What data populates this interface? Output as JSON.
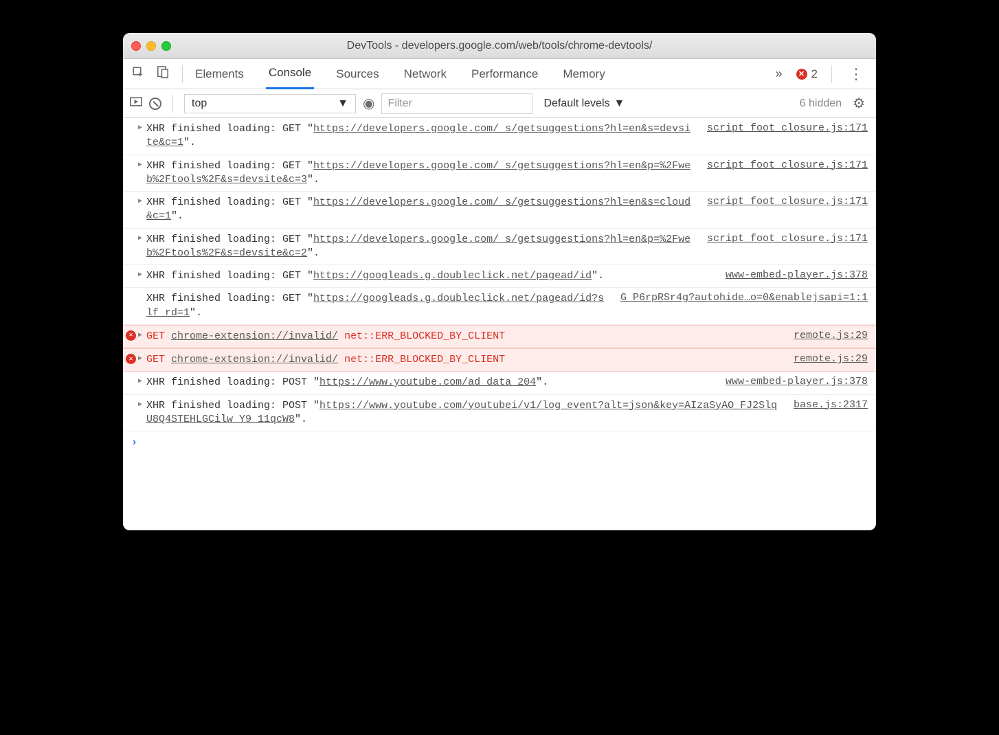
{
  "window": {
    "title": "DevTools - developers.google.com/web/tools/chrome-devtools/"
  },
  "tabs": {
    "items": [
      "Elements",
      "Console",
      "Sources",
      "Network",
      "Performance",
      "Memory"
    ],
    "active": "Console",
    "overflow_glyph": "»",
    "error_count": "2"
  },
  "toolbar": {
    "context": "top",
    "filter_placeholder": "Filter",
    "levels_label": "Default levels",
    "hidden_label": "6 hidden"
  },
  "logs": [
    {
      "type": "xhr",
      "disclosure": true,
      "prefix": "XHR finished loading: GET \"",
      "url": "https://developers.google.com/_s/getsuggestions?hl=en&s=devsite&c=1",
      "suffix": "\".",
      "source": "script_foot_closure.js:171"
    },
    {
      "type": "xhr",
      "disclosure": true,
      "prefix": "XHR finished loading: GET \"",
      "url": "https://developers.google.com/_s/getsuggestions?hl=en&p=%2Fweb%2Ftools%2F&s=devsite&c=3",
      "suffix": "\".",
      "source": "script_foot_closure.js:171"
    },
    {
      "type": "xhr",
      "disclosure": true,
      "prefix": "XHR finished loading: GET \"",
      "url": "https://developers.google.com/_s/getsuggestions?hl=en&s=cloud&c=1",
      "suffix": "\".",
      "source": "script_foot_closure.js:171"
    },
    {
      "type": "xhr",
      "disclosure": true,
      "prefix": "XHR finished loading: GET \"",
      "url": "https://developers.google.com/_s/getsuggestions?hl=en&p=%2Fweb%2Ftools%2F&s=devsite&c=2",
      "suffix": "\".",
      "source": "script_foot_closure.js:171"
    },
    {
      "type": "xhr",
      "disclosure": true,
      "prefix": "XHR finished loading: GET \"",
      "url": "https://googleads.g.doubleclick.net/pagead/id",
      "suffix": "\".",
      "source": "www-embed-player.js:378"
    },
    {
      "type": "xhr",
      "disclosure": false,
      "prefix": "XHR finished loading: GET \"",
      "url": "https://googleads.g.doubleclick.net/pagead/id?slf_rd=1",
      "suffix": "\".",
      "source": "G_P6rpRSr4g?autohide…o=0&enablejsapi=1:1"
    },
    {
      "type": "error",
      "disclosure": true,
      "get_label": "GET",
      "url": "chrome-extension://invalid/",
      "err_text": "net::ERR_BLOCKED_BY_CLIENT",
      "source": "remote.js:29"
    },
    {
      "type": "error",
      "disclosure": true,
      "get_label": "GET",
      "url": "chrome-extension://invalid/",
      "err_text": "net::ERR_BLOCKED_BY_CLIENT",
      "source": "remote.js:29"
    },
    {
      "type": "xhr",
      "disclosure": true,
      "prefix": "XHR finished loading: POST \"",
      "url": "https://www.youtube.com/ad_data_204",
      "suffix": "\".",
      "source": "www-embed-player.js:378"
    },
    {
      "type": "xhr",
      "disclosure": true,
      "prefix": "XHR finished loading: POST \"",
      "url": "https://www.youtube.com/youtubei/v1/log_event?alt=json&key=AIzaSyAO_FJ2SlqU8Q4STEHLGCilw_Y9_11qcW8",
      "suffix": "\".",
      "source": "base.js:2317"
    }
  ]
}
